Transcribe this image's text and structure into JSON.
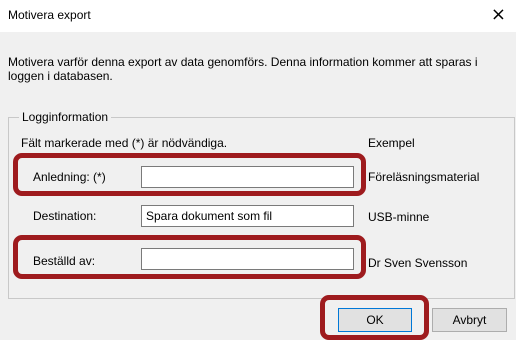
{
  "window": {
    "title": "Motivera export",
    "close_glyph": "×"
  },
  "description": "Motivera varför denna export av data genomförs. Denna information kommer att sparas i loggen i databasen.",
  "group": {
    "legend": "Logginformation",
    "required_note": "Fält markerade med (*) är nödvändiga.",
    "example_header": "Exempel"
  },
  "fields": {
    "reason": {
      "label": "Anledning: (*)",
      "value": "",
      "example": "Föreläsningsmaterial"
    },
    "destination": {
      "label": "Destination:",
      "value": "Spara dokument som fil",
      "example": "USB-minne"
    },
    "ordered_by": {
      "label": "Beställd av:",
      "value": "",
      "example": "Dr Sven Svensson"
    }
  },
  "buttons": {
    "ok": "OK",
    "cancel": "Avbryt"
  },
  "colors": {
    "highlight": "#9e1b1e",
    "default_button_border": "#0078d7"
  }
}
